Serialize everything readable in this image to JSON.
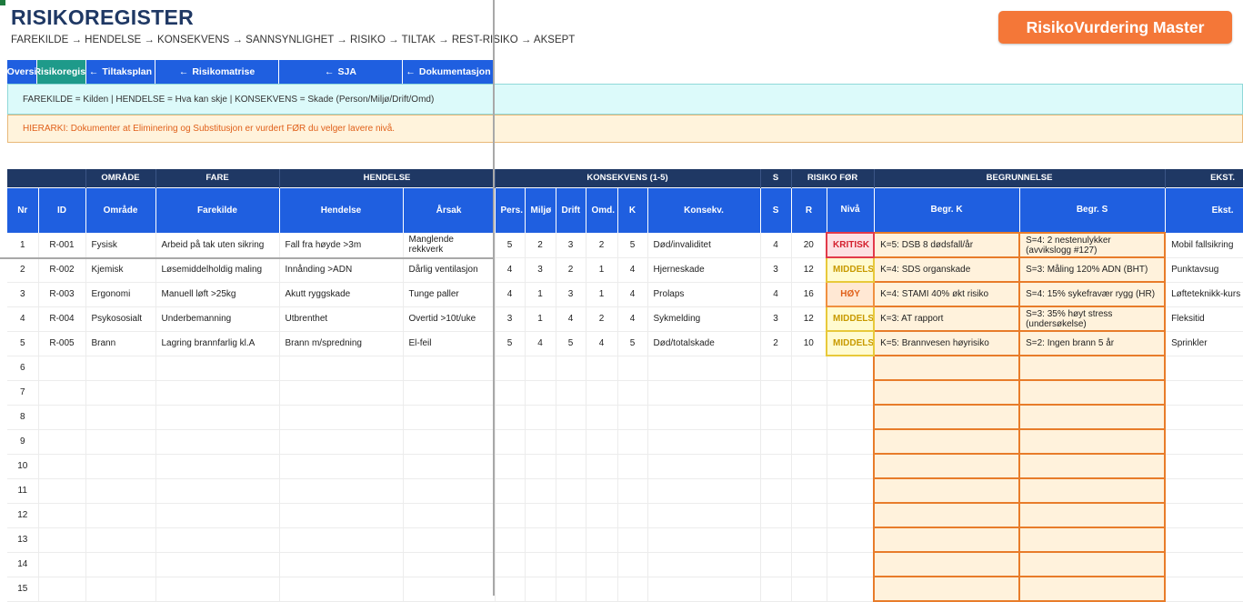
{
  "header": {
    "title": "RISIKOREGISTER",
    "subtitle": "FAREKILDE → HENDELSE → KONSEKVENS → SANNSYNLIGHET → RISIKO → TILTAK → REST-RISIKO → AKSEPT",
    "brand": "RisikoVurdering Master"
  },
  "nav": [
    {
      "label": "Oversi",
      "arrow": ""
    },
    {
      "label": "Risikoregist",
      "arrow": "",
      "active": true
    },
    {
      "label": "Tiltaksplan",
      "arrow": "←"
    },
    {
      "label": "Risikomatrise",
      "arrow": "←"
    },
    {
      "label": "SJA",
      "arrow": "←"
    },
    {
      "label": "Dokumentasjon",
      "arrow": "←"
    }
  ],
  "info": {
    "definitions": "FAREKILDE = Kilden  |  HENDELSE = Hva kan skje  |  KONSEKVENS = Skade (Person/Miljø/Drift/Omd)",
    "hierarchy": "HIERARKI: Dokumenter at Eliminering og Substitusjon er vurdert FØR du velger lavere nivå."
  },
  "table": {
    "groups": [
      {
        "label": "",
        "span": 2
      },
      {
        "label": "OMRÅDE",
        "span": 1
      },
      {
        "label": "FARE",
        "span": 1
      },
      {
        "label": "HENDELSE",
        "span": 2
      },
      {
        "label": "KONSEKVENS (1-5)",
        "span": 6
      },
      {
        "label": "S",
        "span": 1
      },
      {
        "label": "RISIKO FØR",
        "span": 2
      },
      {
        "label": "BEGRUNNELSE",
        "span": 2
      },
      {
        "label": "EKST.",
        "span": 1
      }
    ],
    "columns": [
      "Nr",
      "ID",
      "Område",
      "Farekilde",
      "Hendelse",
      "Årsak",
      "Pers.",
      "Miljø",
      "Drift",
      "Omd.",
      "K",
      "Konsekv.",
      "S",
      "R",
      "Nivå",
      "Begr. K",
      "Begr. S",
      "Ekst."
    ],
    "rows": [
      {
        "nr": "1",
        "id": "R-001",
        "omrade": "Fysisk",
        "farekilde": "Arbeid på tak uten sikring",
        "hendelse": "Fall fra høyde >3m",
        "arsak": "Manglende rekkverk",
        "pers": "5",
        "miljo": "2",
        "drift": "3",
        "omd": "2",
        "k": "5",
        "konsekv": "Død/invaliditet",
        "s": "4",
        "r": "20",
        "niva": "KRITISK",
        "niva_class": "kritisk",
        "begr_k": "K=5: DSB 8 dødsfall/år",
        "begr_s": "S=4: 2 nestenulykker (avvikslogg #127)",
        "ekst": "Mobil fallsikring"
      },
      {
        "nr": "2",
        "id": "R-002",
        "omrade": "Kjemisk",
        "farekilde": "Løsemiddelholdig maling",
        "hendelse": "Innånding >ADN",
        "arsak": "Dårlig ventilasjon",
        "pers": "4",
        "miljo": "3",
        "drift": "2",
        "omd": "1",
        "k": "4",
        "konsekv": "Hjerneskade",
        "s": "3",
        "r": "12",
        "niva": "MIDDELS",
        "niva_class": "middels",
        "begr_k": "K=4: SDS organskade",
        "begr_s": "S=3: Måling 120% ADN (BHT)",
        "ekst": "Punktavsug"
      },
      {
        "nr": "3",
        "id": "R-003",
        "omrade": "Ergonomi",
        "farekilde": "Manuell løft >25kg",
        "hendelse": "Akutt ryggskade",
        "arsak": "Tunge paller",
        "pers": "4",
        "miljo": "1",
        "drift": "3",
        "omd": "1",
        "k": "4",
        "konsekv": "Prolaps",
        "s": "4",
        "r": "16",
        "niva": "HØY",
        "niva_class": "hoy",
        "begr_k": "K=4: STAMI 40% økt risiko",
        "begr_s": "S=4: 15% sykefravær rygg (HR)",
        "ekst": "Løfteteknikk-kurs"
      },
      {
        "nr": "4",
        "id": "R-004",
        "omrade": "Psykososialt",
        "farekilde": "Underbemanning",
        "hendelse": "Utbrenthet",
        "arsak": "Overtid >10t/uke",
        "pers": "3",
        "miljo": "1",
        "drift": "4",
        "omd": "2",
        "k": "4",
        "konsekv": "Sykmelding",
        "s": "3",
        "r": "12",
        "niva": "MIDDELS",
        "niva_class": "middels",
        "begr_k": "K=3: AT rapport",
        "begr_s": "S=3: 35% høyt stress (undersøkelse)",
        "ekst": "Fleksitid"
      },
      {
        "nr": "5",
        "id": "R-005",
        "omrade": "Brann",
        "farekilde": "Lagring brannfarlig kl.A",
        "hendelse": "Brann m/spredning",
        "arsak": "El-feil",
        "pers": "5",
        "miljo": "4",
        "drift": "5",
        "omd": "4",
        "k": "5",
        "konsekv": "Død/totalskade",
        "s": "2",
        "r": "10",
        "niva": "MIDDELS",
        "niva_class": "middels",
        "begr_k": "K=5: Brannvesen høyrisiko",
        "begr_s": "S=2: Ingen brann 5 år",
        "ekst": "Sprinkler"
      },
      {
        "nr": "6"
      },
      {
        "nr": "7"
      },
      {
        "nr": "8"
      },
      {
        "nr": "9"
      },
      {
        "nr": "10"
      },
      {
        "nr": "11"
      },
      {
        "nr": "12"
      },
      {
        "nr": "13"
      },
      {
        "nr": "14"
      },
      {
        "nr": "15"
      }
    ]
  }
}
